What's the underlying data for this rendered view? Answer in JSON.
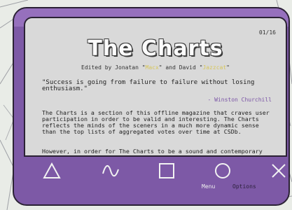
{
  "page_counter": "01/16",
  "magazine": {
    "title": "The Charts",
    "byline_prefix": "Edited by Jonatan \"",
    "byline_name1": "Macx",
    "byline_mid": "\" and David \"",
    "byline_name2": "Jazzcat",
    "byline_suffix": "\""
  },
  "quote": {
    "text": "\"Success is going from failure to failure without losing enthusiasm.\"",
    "author": "- Winston Churchill"
  },
  "body": {
    "paragraph1": "The Charts is a section of this offline magazine that craves user participation in order to be valid and interesting. The Charts reflects the minds of the sceners in a much more dynamic sense than the top lists of aggregated votes over time at CSDb.",
    "paragraph2": "However, in order for The Charts to be a sound and contemporary comment, it is vital that enough readers fill out"
  },
  "controls": {
    "menu_label": "Menu",
    "options_label": "Options"
  },
  "colors": {
    "device": "#7d59a6",
    "screen": "#d9d9d9",
    "accent_yellow": "#d7c65a",
    "accent_purple": "#7b55a6"
  },
  "icons": [
    "triangle-icon",
    "wave-icon",
    "square-icon",
    "circle-icon",
    "close-icon"
  ]
}
